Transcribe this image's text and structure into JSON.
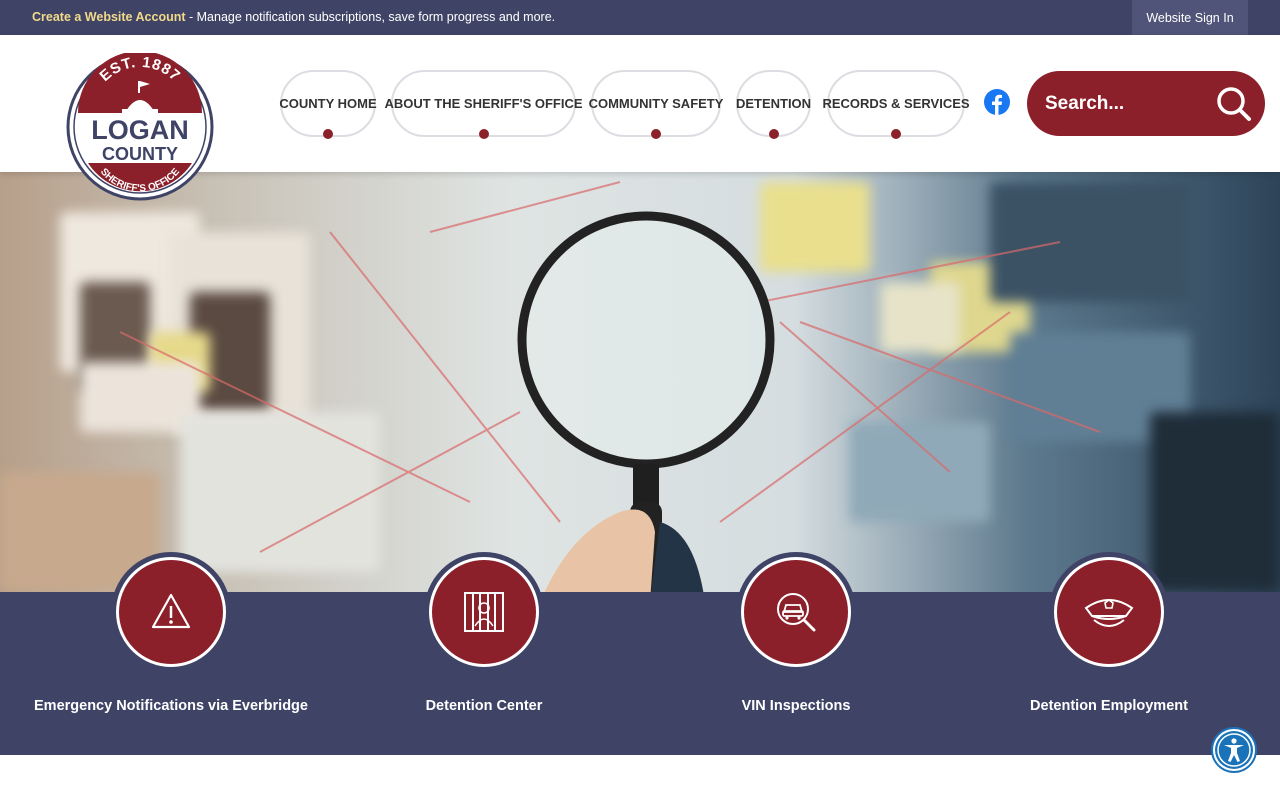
{
  "topbar": {
    "create_account": "Create a Website Account",
    "create_desc": " - Manage notification subscriptions, save form progress and more.",
    "sign_in": "Website Sign In"
  },
  "logo": {
    "est": "EST. 1887",
    "line1": "LOGAN",
    "line2": "COUNTY",
    "line3": "SHERIFF'S OFFICE"
  },
  "nav": {
    "items": [
      {
        "label": "COUNTY HOME"
      },
      {
        "label": "ABOUT THE SHERIFF'S OFFICE"
      },
      {
        "label": "COMMUNITY SAFETY"
      },
      {
        "label": "DETENTION"
      },
      {
        "label": "RECORDS & SERVICES"
      }
    ]
  },
  "search": {
    "placeholder": "Search..."
  },
  "quick_links": [
    {
      "label": "Emergency Notifications via Everbridge",
      "icon": "warning-icon"
    },
    {
      "label": "Detention Center",
      "icon": "jail-bars-icon"
    },
    {
      "label": "VIN Inspections",
      "icon": "car-search-icon"
    },
    {
      "label": "Detention Employment",
      "icon": "officer-hat-icon"
    }
  ],
  "colors": {
    "brand_navy": "#3f4467",
    "brand_red": "#8b1f2a",
    "accent_gold": "#f2d98a"
  }
}
